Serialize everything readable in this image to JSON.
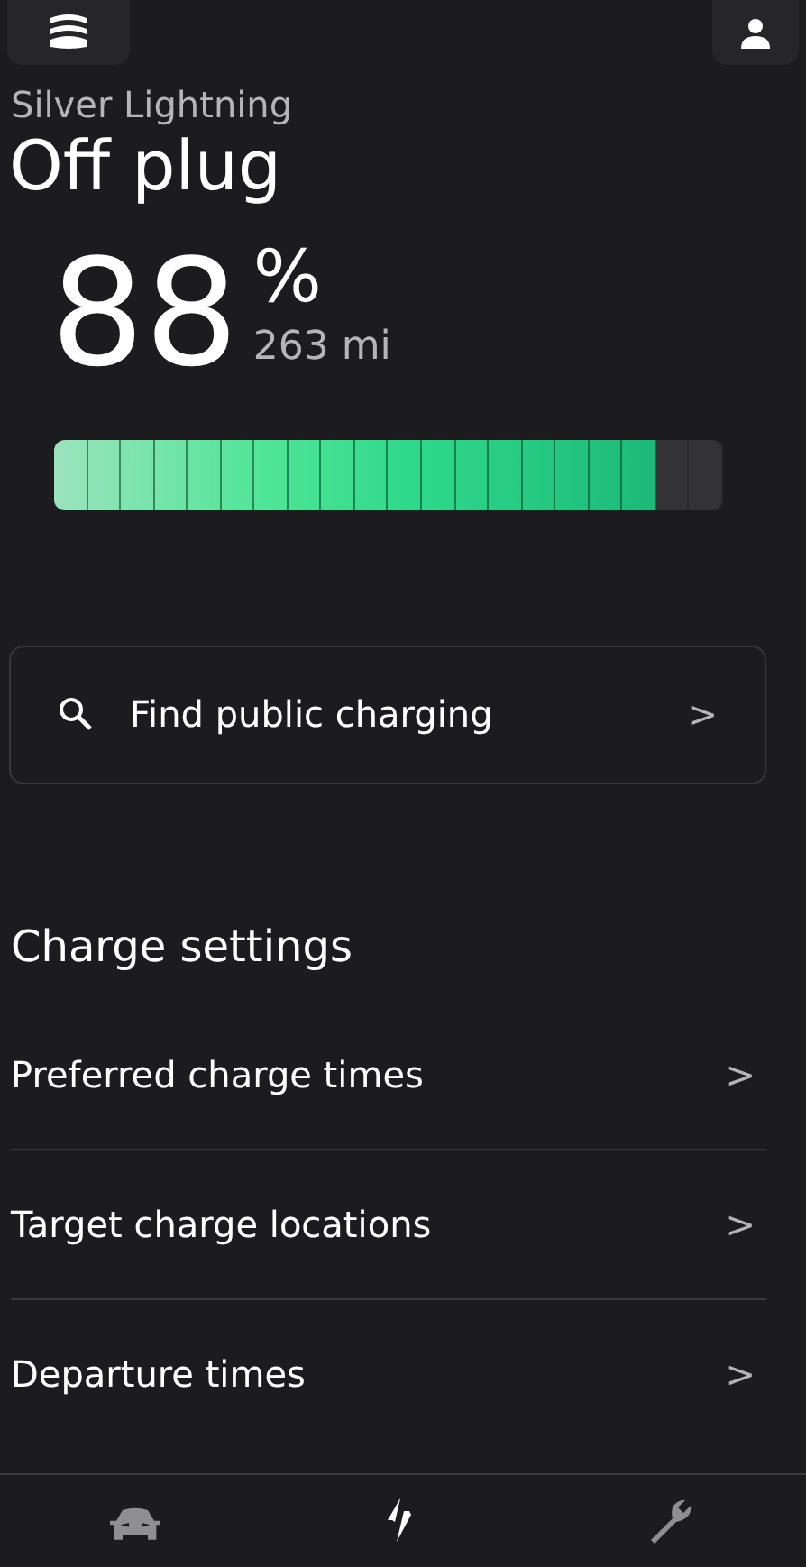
{
  "vehicle_name": "Silver Lightning",
  "status": "Off plug",
  "battery": {
    "percent": "88",
    "unit": "%",
    "range": "263 mi",
    "level": 0.88
  },
  "find_charging": {
    "label": "Find public charging",
    "chevron": ">"
  },
  "charge_settings": {
    "heading": "Charge settings",
    "rows": [
      {
        "label": "Preferred charge times",
        "chevron": ">"
      },
      {
        "label": "Target charge locations",
        "chevron": ">"
      },
      {
        "label": "Departure times",
        "chevron": ">"
      }
    ]
  },
  "bottom_nav": [
    {
      "kind": "car",
      "selected": false
    },
    {
      "kind": "charge",
      "selected": true
    },
    {
      "kind": "service",
      "selected": false
    }
  ]
}
